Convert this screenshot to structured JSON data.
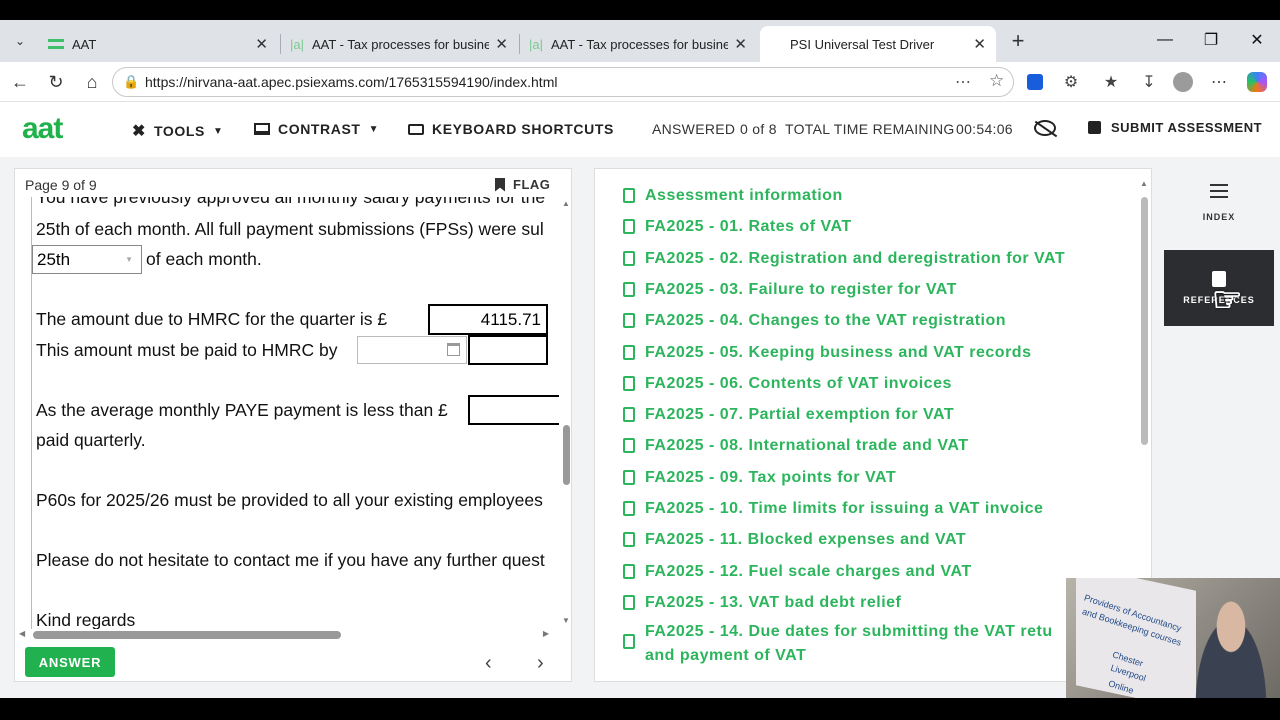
{
  "browser": {
    "tabs": [
      {
        "title": "AAT"
      },
      {
        "title": "AAT - Tax processes for businesses"
      },
      {
        "title": "AAT - Tax processes for businesses"
      },
      {
        "title": "PSI Universal Test Driver"
      }
    ],
    "url": "https://nirvana-aat.apec.psiexams.com/1765315594190/index.html"
  },
  "header": {
    "logo": "aat",
    "tools": "TOOLS",
    "contrast": "CONTRAST",
    "shortcuts": "KEYBOARD SHORTCUTS",
    "answered_label": "ANSWERED",
    "answered_value": "0 of 8",
    "time_label": "TOTAL TIME REMAINING",
    "time_value": "00:54:06",
    "submit": "SUBMIT ASSESSMENT"
  },
  "question": {
    "page": "Page 9 of 9",
    "flag": "FLAG",
    "lines": {
      "l0": "You have previously approved all monthly salary payments for the",
      "l1": "25th of each month. All full payment submissions (FPSs) were sul",
      "l2_suffix": "of each month.",
      "l3": "The amount due to HMRC for the quarter is £",
      "l4": "This amount must be paid to HMRC by",
      "l5a": "As the average monthly PAYE payment is less than £",
      "l5b": "paid quarterly.",
      "l6": "P60s for 2025/26 must be provided to all your existing employees",
      "l7": "Please do not hesitate to contact me if you have any further quest",
      "l8": "Kind regards"
    },
    "select_value": "25th",
    "amount_value": "4115.71",
    "answer_button": "ANSWER"
  },
  "index": {
    "items": [
      "Assessment information",
      "FA2025 - 01. Rates of VAT",
      "FA2025 - 02. Registration and deregistration for VAT",
      "FA2025 - 03. Failure to register for VAT",
      "FA2025 - 04. Changes to the VAT registration",
      "FA2025 - 05. Keeping business and VAT records",
      "FA2025 - 06. Contents of VAT invoices",
      "FA2025 - 07. Partial exemption for VAT",
      "FA2025 - 08. International trade and VAT",
      "FA2025 - 09. Tax points for VAT",
      "FA2025 - 10. Time limits for issuing a VAT invoice",
      "FA2025 - 11. Blocked expenses and VAT",
      "FA2025 - 12. Fuel scale charges and VAT",
      "FA2025 - 13. VAT bad debt relief"
    ],
    "last_item_line1": "FA2025 - 14. Due dates for submitting the VAT retu",
    "last_item_line2": "and payment of VAT"
  },
  "rail": {
    "index_label": "INDEX",
    "references_label": "REFERENCES"
  },
  "webcam": {
    "poster_lines": [
      "Providers of Accountancy",
      "and Bookkeeping courses",
      "Chester",
      "Liverpool",
      "Online"
    ]
  }
}
